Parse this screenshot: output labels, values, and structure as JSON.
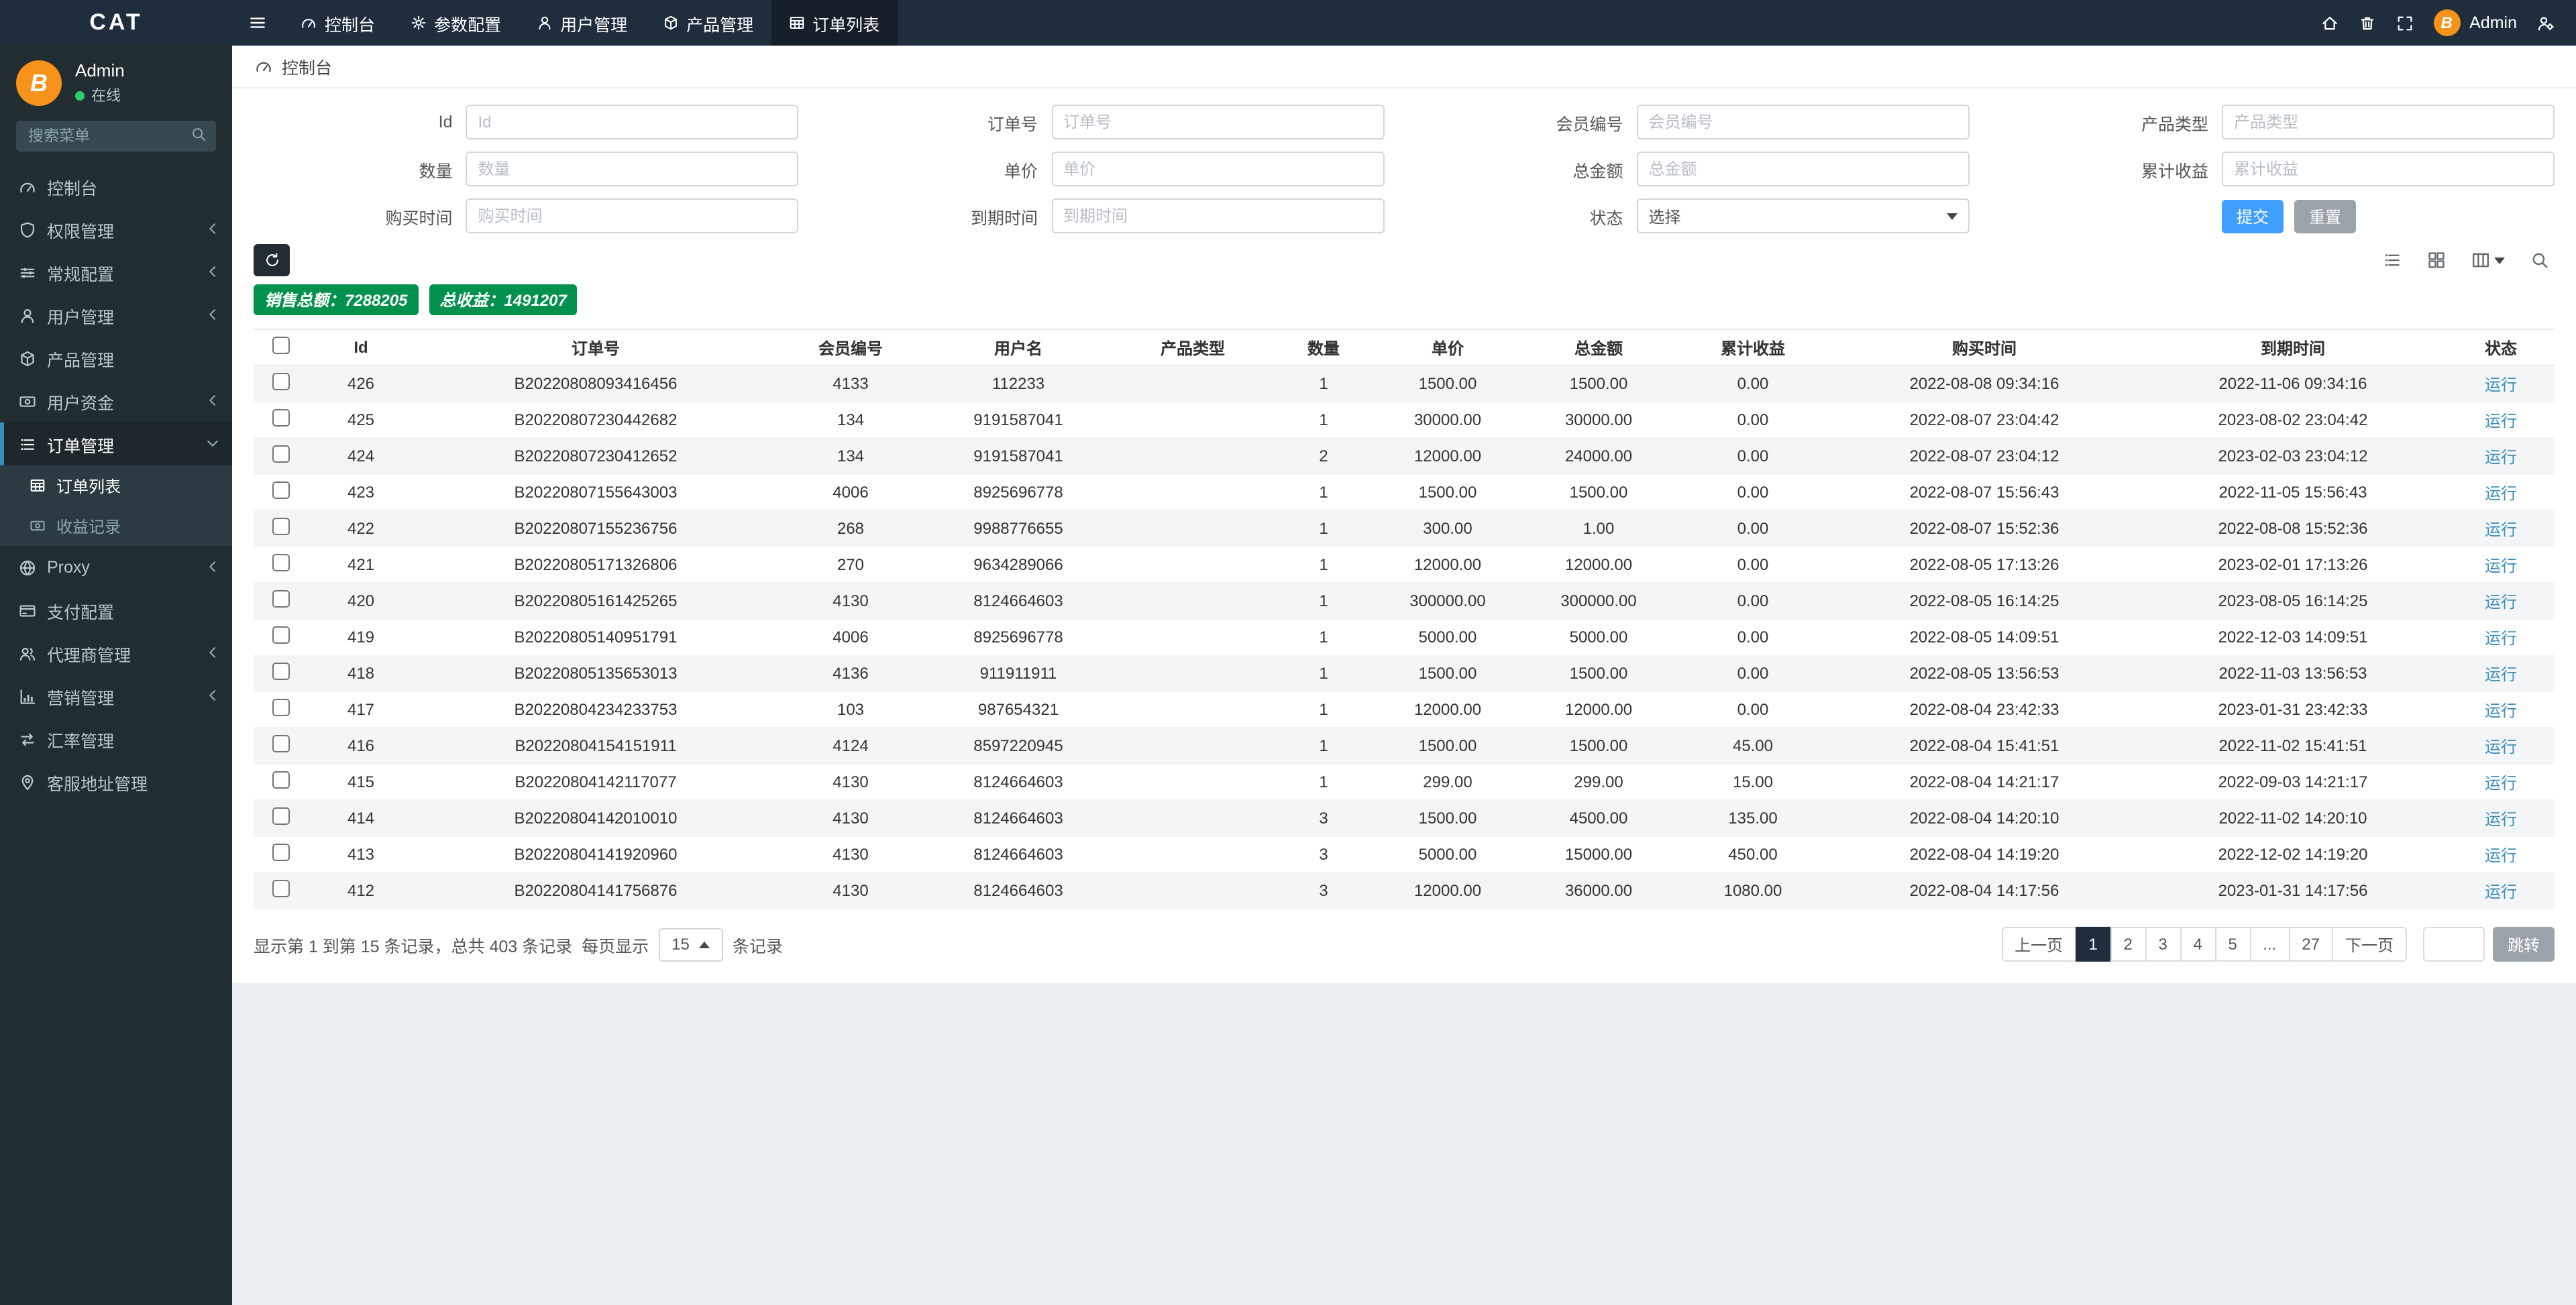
{
  "navbar": {
    "brand": "CAT",
    "tabs": [
      {
        "key": "console",
        "label": "控制台",
        "icon": "gauge",
        "active": false
      },
      {
        "key": "params-config",
        "label": "参数配置",
        "icon": "gear",
        "active": false
      },
      {
        "key": "user-mgmt",
        "label": "用户管理",
        "icon": "user",
        "active": false
      },
      {
        "key": "product-mgmt",
        "label": "产品管理",
        "icon": "cube",
        "active": false
      },
      {
        "key": "order-list",
        "label": "订单列表",
        "icon": "table",
        "active": true
      }
    ],
    "user": {
      "name": "Admin",
      "avatar_letter": "B"
    }
  },
  "sidebar": {
    "user": {
      "name": "Admin",
      "status": "在线",
      "avatar_letter": "B"
    },
    "search_placeholder": "搜索菜单",
    "menu": [
      {
        "key": "console",
        "label": "控制台",
        "icon": "gauge",
        "expandable": false
      },
      {
        "key": "permission-mgmt",
        "label": "权限管理",
        "icon": "shield",
        "expandable": true
      },
      {
        "key": "general-config",
        "label": "常规配置",
        "icon": "sliders",
        "expandable": true
      },
      {
        "key": "user-mgmt",
        "label": "用户管理",
        "icon": "user",
        "expandable": true
      },
      {
        "key": "product-mgmt",
        "label": "产品管理",
        "icon": "cube",
        "expandable": false
      },
      {
        "key": "user-funds",
        "label": "用户资金",
        "icon": "money",
        "expandable": true
      },
      {
        "key": "order-mgmt",
        "label": "订单管理",
        "icon": "list",
        "expandable": true,
        "expanded": true,
        "active": true,
        "children": [
          {
            "key": "order-list",
            "label": "订单列表",
            "icon": "table",
            "active": true
          },
          {
            "key": "income-records",
            "label": "收益记录",
            "icon": "money",
            "active": false
          }
        ]
      },
      {
        "key": "proxy",
        "label": "Proxy",
        "icon": "globe",
        "expandable": true
      },
      {
        "key": "pay-config",
        "label": "支付配置",
        "icon": "card",
        "expandable": false
      },
      {
        "key": "agent-mgmt",
        "label": "代理商管理",
        "icon": "users",
        "expandable": true
      },
      {
        "key": "marketing-mgmt",
        "label": "营销管理",
        "icon": "chart",
        "expandable": true
      },
      {
        "key": "rate-mgmt",
        "label": "汇率管理",
        "icon": "exchange",
        "expandable": false
      },
      {
        "key": "service-address-mgmt",
        "label": "客服地址管理",
        "icon": "pin",
        "expandable": false
      }
    ]
  },
  "breadcrumb": {
    "label": "控制台"
  },
  "filter": {
    "fields": [
      {
        "key": "id",
        "label": "Id",
        "placeholder": "Id",
        "type": "text"
      },
      {
        "key": "order-no",
        "label": "订单号",
        "placeholder": "订单号",
        "type": "text"
      },
      {
        "key": "member-no",
        "label": "会员编号",
        "placeholder": "会员编号",
        "type": "text"
      },
      {
        "key": "product-type",
        "label": "产品类型",
        "placeholder": "产品类型",
        "type": "text"
      },
      {
        "key": "quantity",
        "label": "数量",
        "placeholder": "数量",
        "type": "text"
      },
      {
        "key": "unit-price",
        "label": "单价",
        "placeholder": "单价",
        "type": "text"
      },
      {
        "key": "total-amount",
        "label": "总金额",
        "placeholder": "总金额",
        "type": "text"
      },
      {
        "key": "total-income",
        "label": "累计收益",
        "placeholder": "累计收益",
        "type": "text"
      },
      {
        "key": "buy-time",
        "label": "购买时间",
        "placeholder": "购买时间",
        "type": "text"
      },
      {
        "key": "expire-time",
        "label": "到期时间",
        "placeholder": "到期时间",
        "type": "text"
      },
      {
        "key": "status",
        "label": "状态",
        "value": "选择",
        "type": "select"
      }
    ],
    "submit_label": "提交",
    "reset_label": "重置"
  },
  "summary": {
    "sales_total_label": "销售总额：7288205",
    "income_total_label": "总收益：1491207"
  },
  "table": {
    "columns": [
      "Id",
      "订单号",
      "会员编号",
      "用户名",
      "产品类型",
      "数量",
      "单价",
      "总金额",
      "累计收益",
      "购买时间",
      "到期时间",
      "状态"
    ],
    "rows": [
      [
        "426",
        "B20220808093416456",
        "4133",
        "112233",
        "",
        "1",
        "1500.00",
        "1500.00",
        "0.00",
        "2022-08-08 09:34:16",
        "2022-11-06 09:34:16",
        "运行"
      ],
      [
        "425",
        "B20220807230442682",
        "134",
        "9191587041",
        "",
        "1",
        "30000.00",
        "30000.00",
        "0.00",
        "2022-08-07 23:04:42",
        "2023-08-02 23:04:42",
        "运行"
      ],
      [
        "424",
        "B20220807230412652",
        "134",
        "9191587041",
        "",
        "2",
        "12000.00",
        "24000.00",
        "0.00",
        "2022-08-07 23:04:12",
        "2023-02-03 23:04:12",
        "运行"
      ],
      [
        "423",
        "B20220807155643003",
        "4006",
        "8925696778",
        "",
        "1",
        "1500.00",
        "1500.00",
        "0.00",
        "2022-08-07 15:56:43",
        "2022-11-05 15:56:43",
        "运行"
      ],
      [
        "422",
        "B20220807155236756",
        "268",
        "9988776655",
        "",
        "1",
        "300.00",
        "1.00",
        "0.00",
        "2022-08-07 15:52:36",
        "2022-08-08 15:52:36",
        "运行"
      ],
      [
        "421",
        "B20220805171326806",
        "270",
        "9634289066",
        "",
        "1",
        "12000.00",
        "12000.00",
        "0.00",
        "2022-08-05 17:13:26",
        "2023-02-01 17:13:26",
        "运行"
      ],
      [
        "420",
        "B20220805161425265",
        "4130",
        "8124664603",
        "",
        "1",
        "300000.00",
        "300000.00",
        "0.00",
        "2022-08-05 16:14:25",
        "2023-08-05 16:14:25",
        "运行"
      ],
      [
        "419",
        "B20220805140951791",
        "4006",
        "8925696778",
        "",
        "1",
        "5000.00",
        "5000.00",
        "0.00",
        "2022-08-05 14:09:51",
        "2022-12-03 14:09:51",
        "运行"
      ],
      [
        "418",
        "B20220805135653013",
        "4136",
        "911911911",
        "",
        "1",
        "1500.00",
        "1500.00",
        "0.00",
        "2022-08-05 13:56:53",
        "2022-11-03 13:56:53",
        "运行"
      ],
      [
        "417",
        "B20220804234233753",
        "103",
        "987654321",
        "",
        "1",
        "12000.00",
        "12000.00",
        "0.00",
        "2022-08-04 23:42:33",
        "2023-01-31 23:42:33",
        "运行"
      ],
      [
        "416",
        "B20220804154151911",
        "4124",
        "8597220945",
        "",
        "1",
        "1500.00",
        "1500.00",
        "45.00",
        "2022-08-04 15:41:51",
        "2022-11-02 15:41:51",
        "运行"
      ],
      [
        "415",
        "B20220804142117077",
        "4130",
        "8124664603",
        "",
        "1",
        "299.00",
        "299.00",
        "15.00",
        "2022-08-04 14:21:17",
        "2022-09-03 14:21:17",
        "运行"
      ],
      [
        "414",
        "B20220804142010010",
        "4130",
        "8124664603",
        "",
        "3",
        "1500.00",
        "4500.00",
        "135.00",
        "2022-08-04 14:20:10",
        "2022-11-02 14:20:10",
        "运行"
      ],
      [
        "413",
        "B20220804141920960",
        "4130",
        "8124664603",
        "",
        "3",
        "5000.00",
        "15000.00",
        "450.00",
        "2022-08-04 14:19:20",
        "2022-12-02 14:19:20",
        "运行"
      ],
      [
        "412",
        "B20220804141756876",
        "4130",
        "8124664603",
        "",
        "3",
        "12000.00",
        "36000.00",
        "1080.00",
        "2022-08-04 14:17:56",
        "2023-01-31 14:17:56",
        "运行"
      ]
    ]
  },
  "pagination": {
    "info": "显示第 1 到第 15 条记录，总共 403 条记录",
    "per_page_prefix": "每页显示",
    "per_page": "15",
    "per_page_suffix": "条记录",
    "prev_label": "上一页",
    "next_label": "下一页",
    "pages": [
      "1",
      "2",
      "3",
      "4",
      "5",
      "...",
      "27"
    ],
    "active_page": "1",
    "jump_label": "跳转"
  }
}
